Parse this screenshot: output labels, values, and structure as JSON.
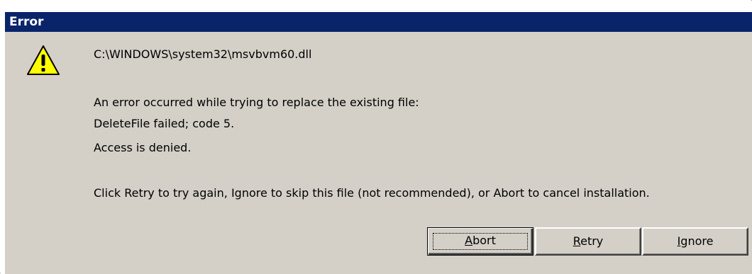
{
  "window": {
    "title": "Error"
  },
  "icon": "warning-icon",
  "message": {
    "file_path": "C:\\WINDOWS\\system32\\msvbvm60.dll",
    "line1": "An error occurred while trying to replace the existing file:",
    "line2": "DeleteFile failed; code 5.",
    "line3": "Access is denied.",
    "instruction": "Click Retry to try again, Ignore to skip this file (not recommended), or Abort to cancel installation."
  },
  "buttons": {
    "abort": {
      "first": "A",
      "rest": "bort"
    },
    "retry": {
      "first": "R",
      "rest": "etry"
    },
    "ignore": {
      "first": "I",
      "rest": "gnore"
    }
  },
  "colors": {
    "titlebar": "#0a246a",
    "face": "#d4d0c8"
  }
}
